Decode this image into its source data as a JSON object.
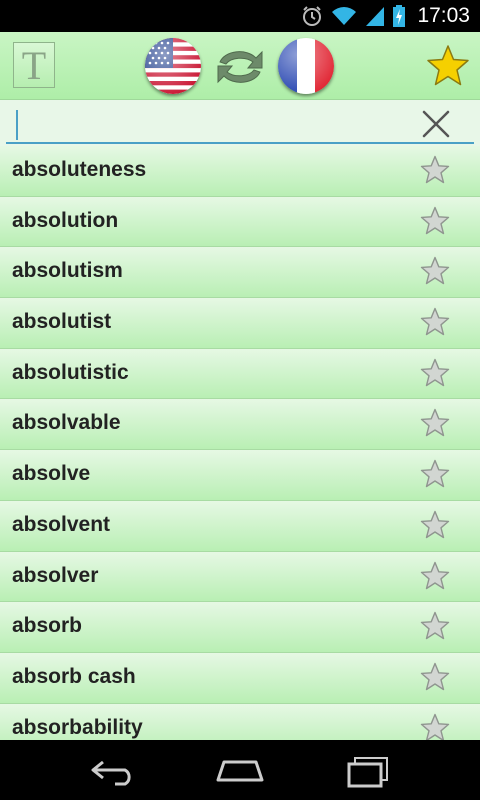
{
  "status_bar": {
    "time": "17:03",
    "icons": [
      "alarm-icon",
      "wifi-icon",
      "signal-icon",
      "battery-charging-icon"
    ]
  },
  "toolbar": {
    "text_button_glyph": "T",
    "source_language_flag": "us-flag-icon",
    "swap_icon": "swap-icon",
    "target_language_flag": "fr-flag-icon",
    "favorites_icon": "star-icon"
  },
  "search": {
    "value": "",
    "placeholder": ""
  },
  "words": [
    "absoluteness",
    "absolution",
    "absolutism",
    "absolutist",
    "absolutistic",
    "absolvable",
    "absolve",
    "absolvent",
    "absolver",
    "absorb",
    "absorb cash",
    "absorbability"
  ],
  "navigation": [
    "back-icon",
    "home-icon",
    "recent-apps-icon"
  ],
  "colors": {
    "toolbar_top": "#c9f5c4",
    "row_bottom": "#b9efb4",
    "accent": "#4aa0c6",
    "star_gold": "#f5d000"
  }
}
